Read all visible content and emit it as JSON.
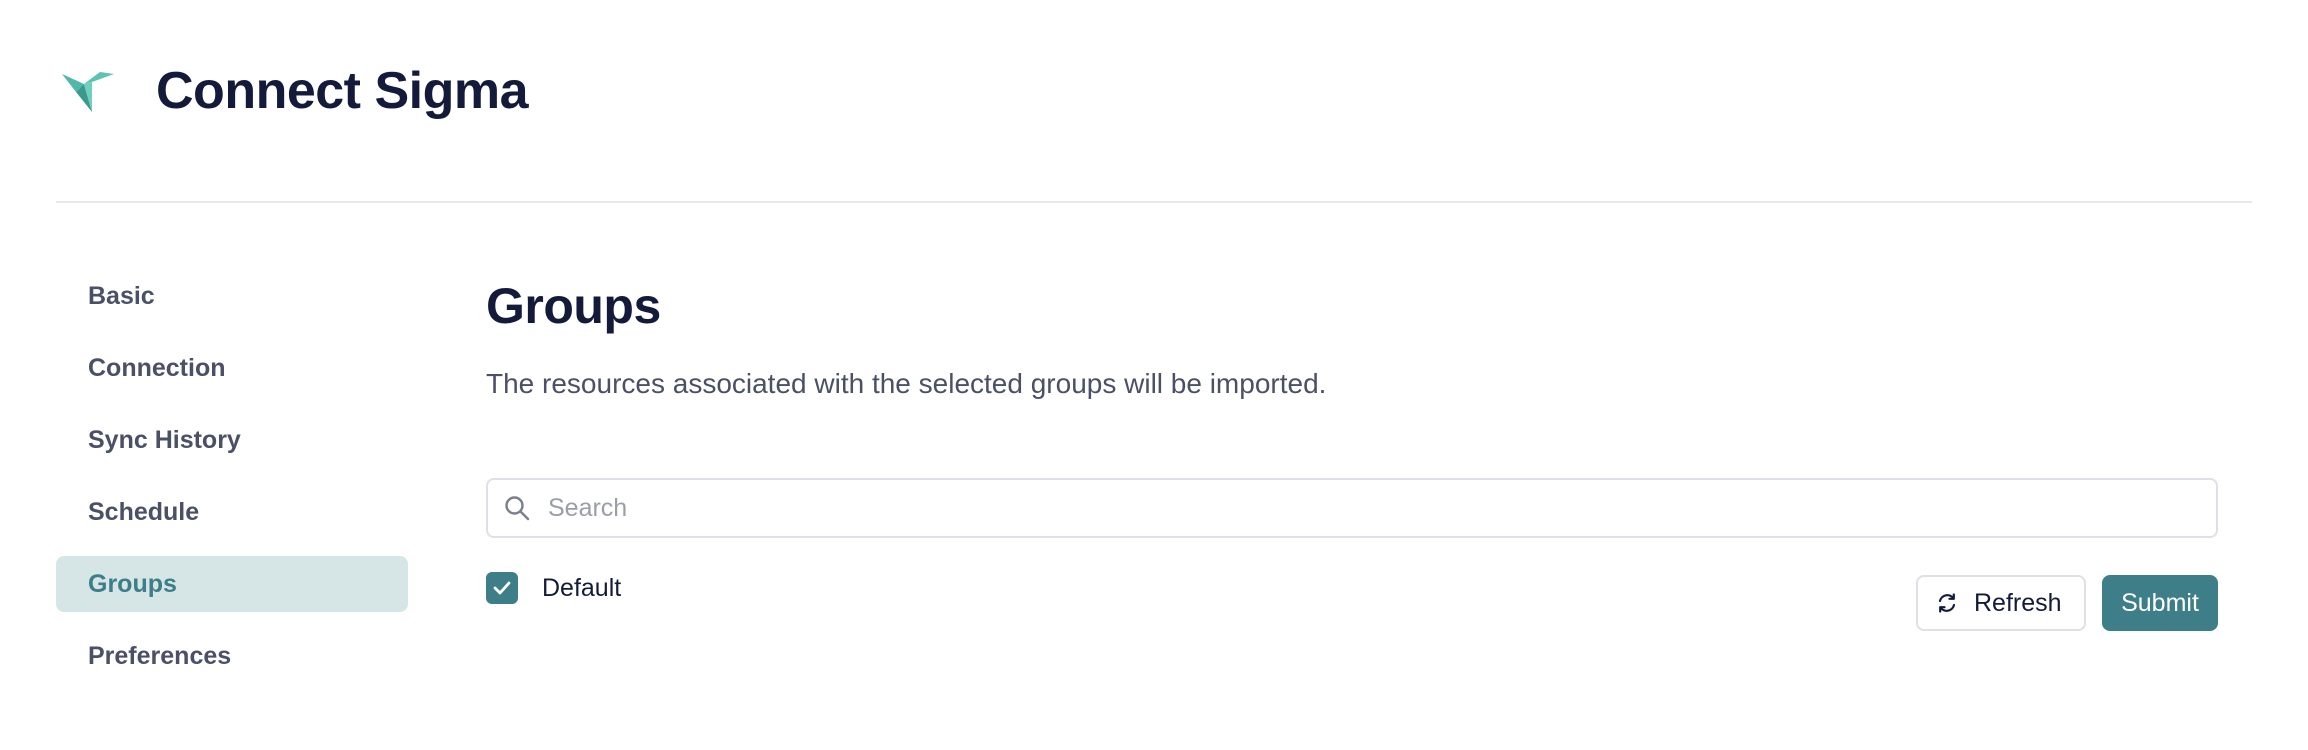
{
  "header": {
    "title": "Connect Sigma",
    "logo_icon": "sigma-bird-logo-icon",
    "logo_color": "#4fb8a8"
  },
  "sidebar": {
    "items": [
      {
        "label": "Basic",
        "active": false
      },
      {
        "label": "Connection",
        "active": false
      },
      {
        "label": "Sync History",
        "active": false
      },
      {
        "label": "Schedule",
        "active": false
      },
      {
        "label": "Groups",
        "active": true
      },
      {
        "label": "Preferences",
        "active": false
      }
    ]
  },
  "main": {
    "title": "Groups",
    "description": "The resources associated with the selected groups will be imported.",
    "search": {
      "placeholder": "Search",
      "value": "",
      "icon": "search-icon"
    },
    "groups": [
      {
        "label": "Default",
        "checked": true
      }
    ],
    "refresh_label": "Refresh",
    "refresh_icon": "refresh-icon",
    "submit_label": "Submit"
  },
  "colors": {
    "accent": "#3d7e89",
    "active_nav_bg": "#d6e5e6",
    "heading": "#131a3a",
    "muted_text": "#4a5066",
    "border": "#dde0e6"
  }
}
